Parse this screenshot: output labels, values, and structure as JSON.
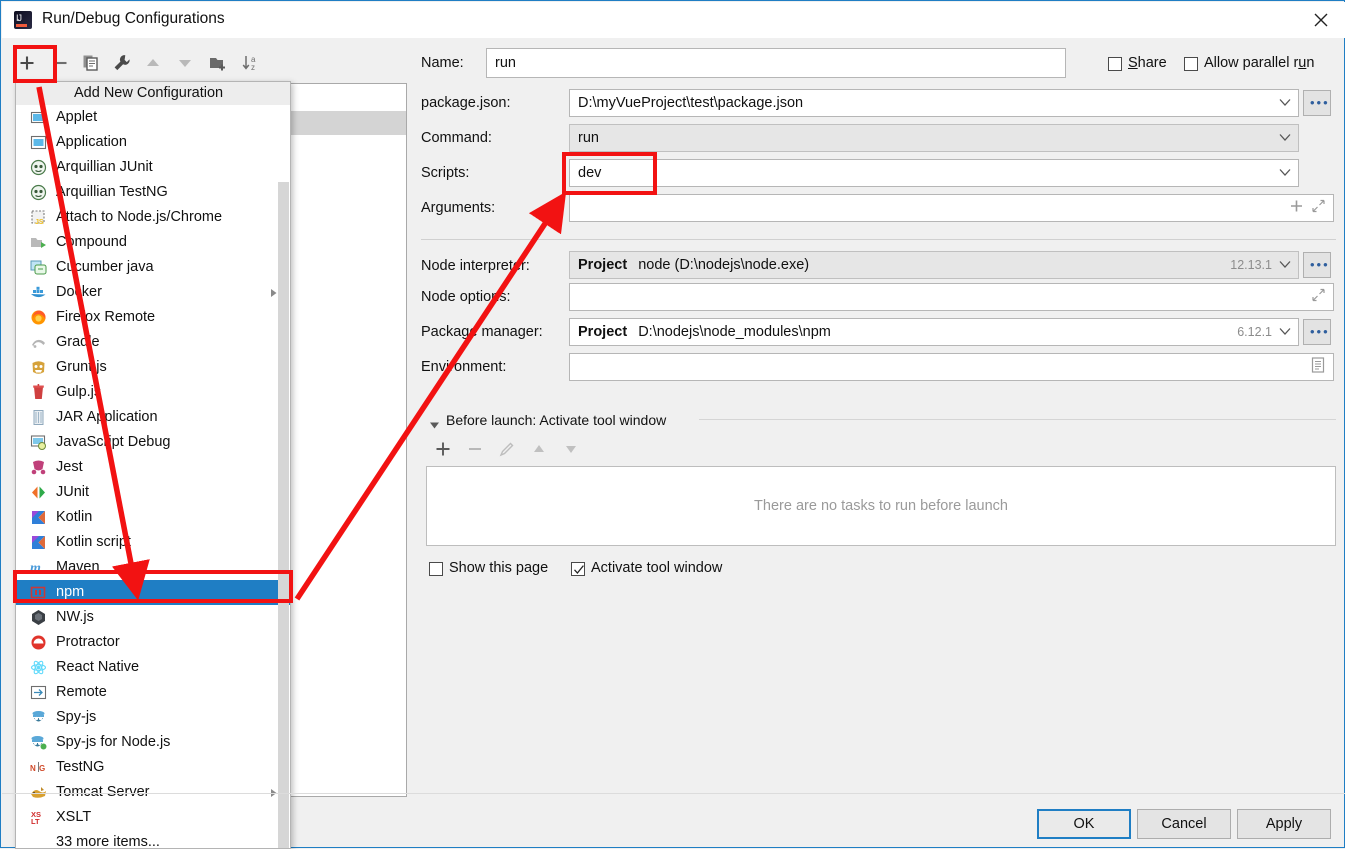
{
  "window": {
    "title": "Run/Debug Configurations",
    "app_icon": "intellij-idea-icon",
    "close_icon": "close-icon"
  },
  "left_toolbar": {
    "buttons": [
      {
        "name": "add-configuration-button",
        "icon": "plus-icon",
        "tooltip": "Add New Configuration"
      },
      {
        "name": "remove-configuration-button",
        "icon": "minus-icon"
      },
      {
        "name": "copy-configuration-button",
        "icon": "copy-icon"
      },
      {
        "name": "edit-templates-button",
        "icon": "wrench-icon"
      },
      {
        "name": "move-up-button",
        "icon": "arrow-up-icon"
      },
      {
        "name": "move-down-button",
        "icon": "arrow-down-icon"
      },
      {
        "name": "create-folder-button",
        "icon": "folder-add-icon"
      },
      {
        "name": "sort-configurations-button",
        "icon": "sort-az-icon"
      }
    ]
  },
  "popup": {
    "header": "Add New Configuration",
    "items": [
      {
        "label": "Applet",
        "icon": "applet-icon",
        "submenu": false,
        "selected": false
      },
      {
        "label": "Application",
        "icon": "application-icon",
        "submenu": false,
        "selected": false
      },
      {
        "label": "Arquillian JUnit",
        "icon": "arquillian-icon",
        "submenu": false,
        "selected": false
      },
      {
        "label": "Arquillian TestNG",
        "icon": "arquillian-icon",
        "submenu": false,
        "selected": false
      },
      {
        "label": "Attach to Node.js/Chrome",
        "icon": "nodejs-attach-icon",
        "submenu": false,
        "selected": false
      },
      {
        "label": "Compound",
        "icon": "compound-icon",
        "submenu": false,
        "selected": false
      },
      {
        "label": "Cucumber java",
        "icon": "cucumber-icon",
        "submenu": false,
        "selected": false
      },
      {
        "label": "Docker",
        "icon": "docker-icon",
        "submenu": true,
        "selected": false
      },
      {
        "label": "Firefox Remote",
        "icon": "firefox-icon",
        "submenu": false,
        "selected": false
      },
      {
        "label": "Gradle",
        "icon": "gradle-icon",
        "submenu": false,
        "selected": false
      },
      {
        "label": "Grunt.js",
        "icon": "grunt-icon",
        "submenu": false,
        "selected": false
      },
      {
        "label": "Gulp.js",
        "icon": "gulp-icon",
        "submenu": false,
        "selected": false
      },
      {
        "label": "JAR Application",
        "icon": "jar-icon",
        "submenu": false,
        "selected": false
      },
      {
        "label": "JavaScript Debug",
        "icon": "javascript-debug-icon",
        "submenu": false,
        "selected": false
      },
      {
        "label": "Jest",
        "icon": "jest-icon",
        "submenu": false,
        "selected": false
      },
      {
        "label": "JUnit",
        "icon": "junit-icon",
        "submenu": false,
        "selected": false
      },
      {
        "label": "Kotlin",
        "icon": "kotlin-icon",
        "submenu": false,
        "selected": false
      },
      {
        "label": "Kotlin script",
        "icon": "kotlin-icon",
        "submenu": false,
        "selected": false
      },
      {
        "label": "Maven",
        "icon": "maven-icon",
        "submenu": false,
        "selected": false
      },
      {
        "label": "npm",
        "icon": "npm-icon",
        "submenu": false,
        "selected": true
      },
      {
        "label": "NW.js",
        "icon": "nwjs-icon",
        "submenu": false,
        "selected": false
      },
      {
        "label": "Protractor",
        "icon": "protractor-icon",
        "submenu": false,
        "selected": false
      },
      {
        "label": "React Native",
        "icon": "react-icon",
        "submenu": false,
        "selected": false
      },
      {
        "label": "Remote",
        "icon": "remote-icon",
        "submenu": false,
        "selected": false
      },
      {
        "label": "Spy-js",
        "icon": "spyjs-icon",
        "submenu": false,
        "selected": false
      },
      {
        "label": "Spy-js for Node.js",
        "icon": "spyjs-node-icon",
        "submenu": false,
        "selected": false
      },
      {
        "label": "TestNG",
        "icon": "testng-icon",
        "submenu": false,
        "selected": false
      },
      {
        "label": "Tomcat Server",
        "icon": "tomcat-icon",
        "submenu": true,
        "selected": false
      },
      {
        "label": "XSLT",
        "icon": "xslt-icon",
        "submenu": false,
        "selected": false
      },
      {
        "label": "33 more items...",
        "icon": "none",
        "submenu": false,
        "selected": false
      }
    ]
  },
  "form": {
    "name_label": "Name:",
    "name_value": "run",
    "share_label_pre": "",
    "share_label": "Share",
    "allow_parallel_label": "Allow parallel run",
    "share_checked": false,
    "allow_parallel_checked": false,
    "package_json_label": "package.json:",
    "package_json_value": "D:\\myVueProject\\test\\package.json",
    "command_label": "Command:",
    "command_value": "run",
    "scripts_label": "Scripts:",
    "scripts_value": "dev",
    "arguments_label": "Arguments:",
    "arguments_value": "",
    "node_interpreter_label": "Node interpreter:",
    "node_interpreter_prefix": "Project",
    "node_interpreter_value": "node (D:\\nodejs\\node.exe)",
    "node_interpreter_version": "12.13.1",
    "node_options_label": "Node options:",
    "node_options_value": "",
    "package_manager_label": "Package manager:",
    "package_manager_prefix": "Project",
    "package_manager_value": "D:\\nodejs\\node_modules\\npm",
    "package_manager_version": "6.12.1",
    "environment_label": "Environment:",
    "environment_value": "",
    "ellipsis_label": "..."
  },
  "before_launch": {
    "title": "Before launch: Activate tool window",
    "toolbar": [
      {
        "name": "add-task-button",
        "icon": "plus-icon"
      },
      {
        "name": "remove-task-button",
        "icon": "minus-icon"
      },
      {
        "name": "edit-task-button",
        "icon": "pencil-icon"
      },
      {
        "name": "move-task-up-button",
        "icon": "arrow-up-icon"
      },
      {
        "name": "move-task-down-button",
        "icon": "arrow-down-icon"
      }
    ],
    "empty_text": "There are no tasks to run before launch",
    "show_page_label": "Show this page",
    "show_page_checked": false,
    "activate_tool_window_label": "Activate tool window",
    "activate_tool_window_checked": true
  },
  "footer": {
    "ok": "OK",
    "cancel": "Cancel",
    "apply": "Apply"
  },
  "annotations": {
    "highlight_color": "#f21212",
    "boxes": [
      "add-configuration-button",
      "npm-list-item",
      "scripts-value-field"
    ],
    "arrows": [
      "plus-to-npm-arrow",
      "npm-to-scripts-arrow"
    ]
  }
}
